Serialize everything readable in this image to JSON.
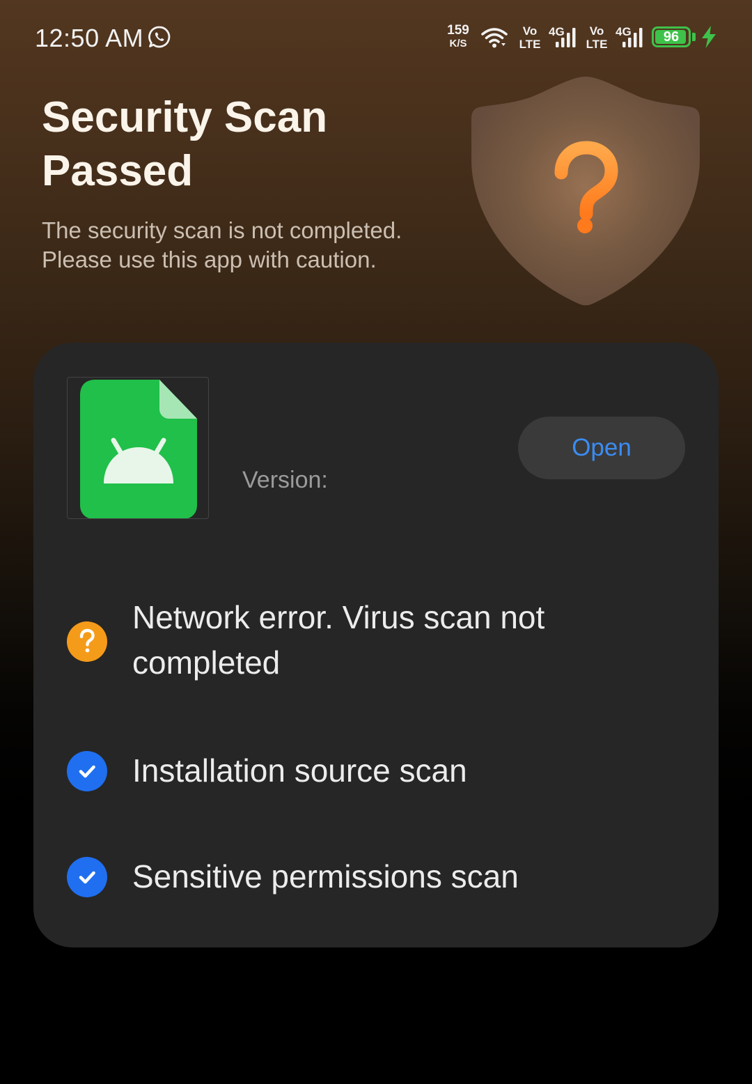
{
  "status_bar": {
    "time": "12:50 AM",
    "net_speed_value": "159",
    "net_speed_unit": "K/S",
    "sim1": {
      "vo": "Vo",
      "lte": "LTE",
      "gen": "4G"
    },
    "sim2": {
      "vo": "Vo",
      "lte": "LTE",
      "gen": "4G"
    },
    "battery_level": "96",
    "battery_fraction": 0.96,
    "charging": true,
    "icons": [
      "whatsapp-icon",
      "wifi-icon",
      "signal-icon",
      "battery-icon",
      "charging-icon"
    ]
  },
  "header": {
    "title": "Security Scan Passed",
    "subtitle": "The security scan is not completed. Please use this app with caution.",
    "shield_icon": "shield-question-icon"
  },
  "app": {
    "icon": "android-apk-file-icon",
    "version_label": "Version:",
    "open_label": "Open"
  },
  "scan_results": [
    {
      "label": "Network error. Virus scan not completed",
      "status": "warning",
      "icon": "question-circle-icon"
    },
    {
      "label": "Installation source scan",
      "status": "passed",
      "icon": "check-circle-icon"
    },
    {
      "label": "Sensitive permissions scan",
      "status": "passed",
      "icon": "check-circle-icon"
    }
  ],
  "colors": {
    "warning": "#f59b1a",
    "passed": "#1f6ff0",
    "accent_link": "#3b8cf2",
    "battery": "#3ec24a",
    "card_background": "#262626"
  }
}
